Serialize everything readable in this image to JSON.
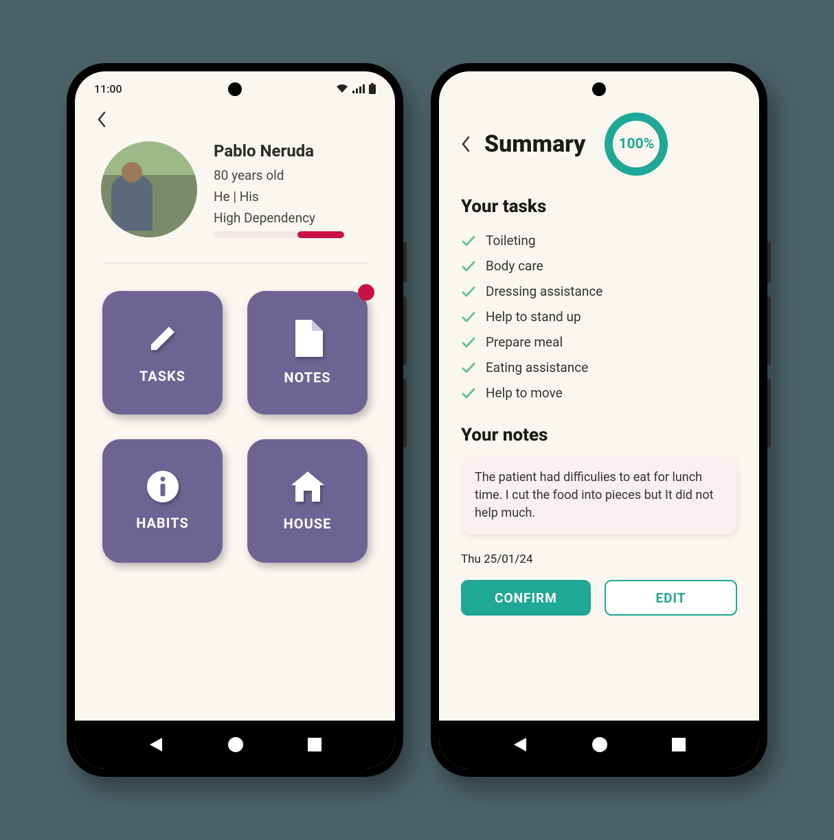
{
  "status": {
    "time": "11:00"
  },
  "phone1": {
    "profile": {
      "name": "Pablo Neruda",
      "age": "80 years old",
      "pronouns": "He | His",
      "dependency": "High Dependency"
    },
    "tiles": {
      "tasks": "TASKS",
      "notes": "NOTES",
      "habits": "HABITS",
      "house": "HOUSE"
    }
  },
  "phone2": {
    "title": "Summary",
    "progress": "100%",
    "tasks_heading": "Your tasks",
    "tasks": [
      "Toileting",
      "Body care",
      "Dressing assistance",
      "Help to stand up",
      "Prepare meal",
      "Eating assistance",
      "Help to move"
    ],
    "notes_heading": "Your notes",
    "note": "The patient had difficulies to eat for lunch time. I cut the food into pieces but It did not help much.",
    "date": "Thu 25/01/24",
    "buttons": {
      "confirm": "CONFIRM",
      "edit": "EDIT"
    }
  }
}
